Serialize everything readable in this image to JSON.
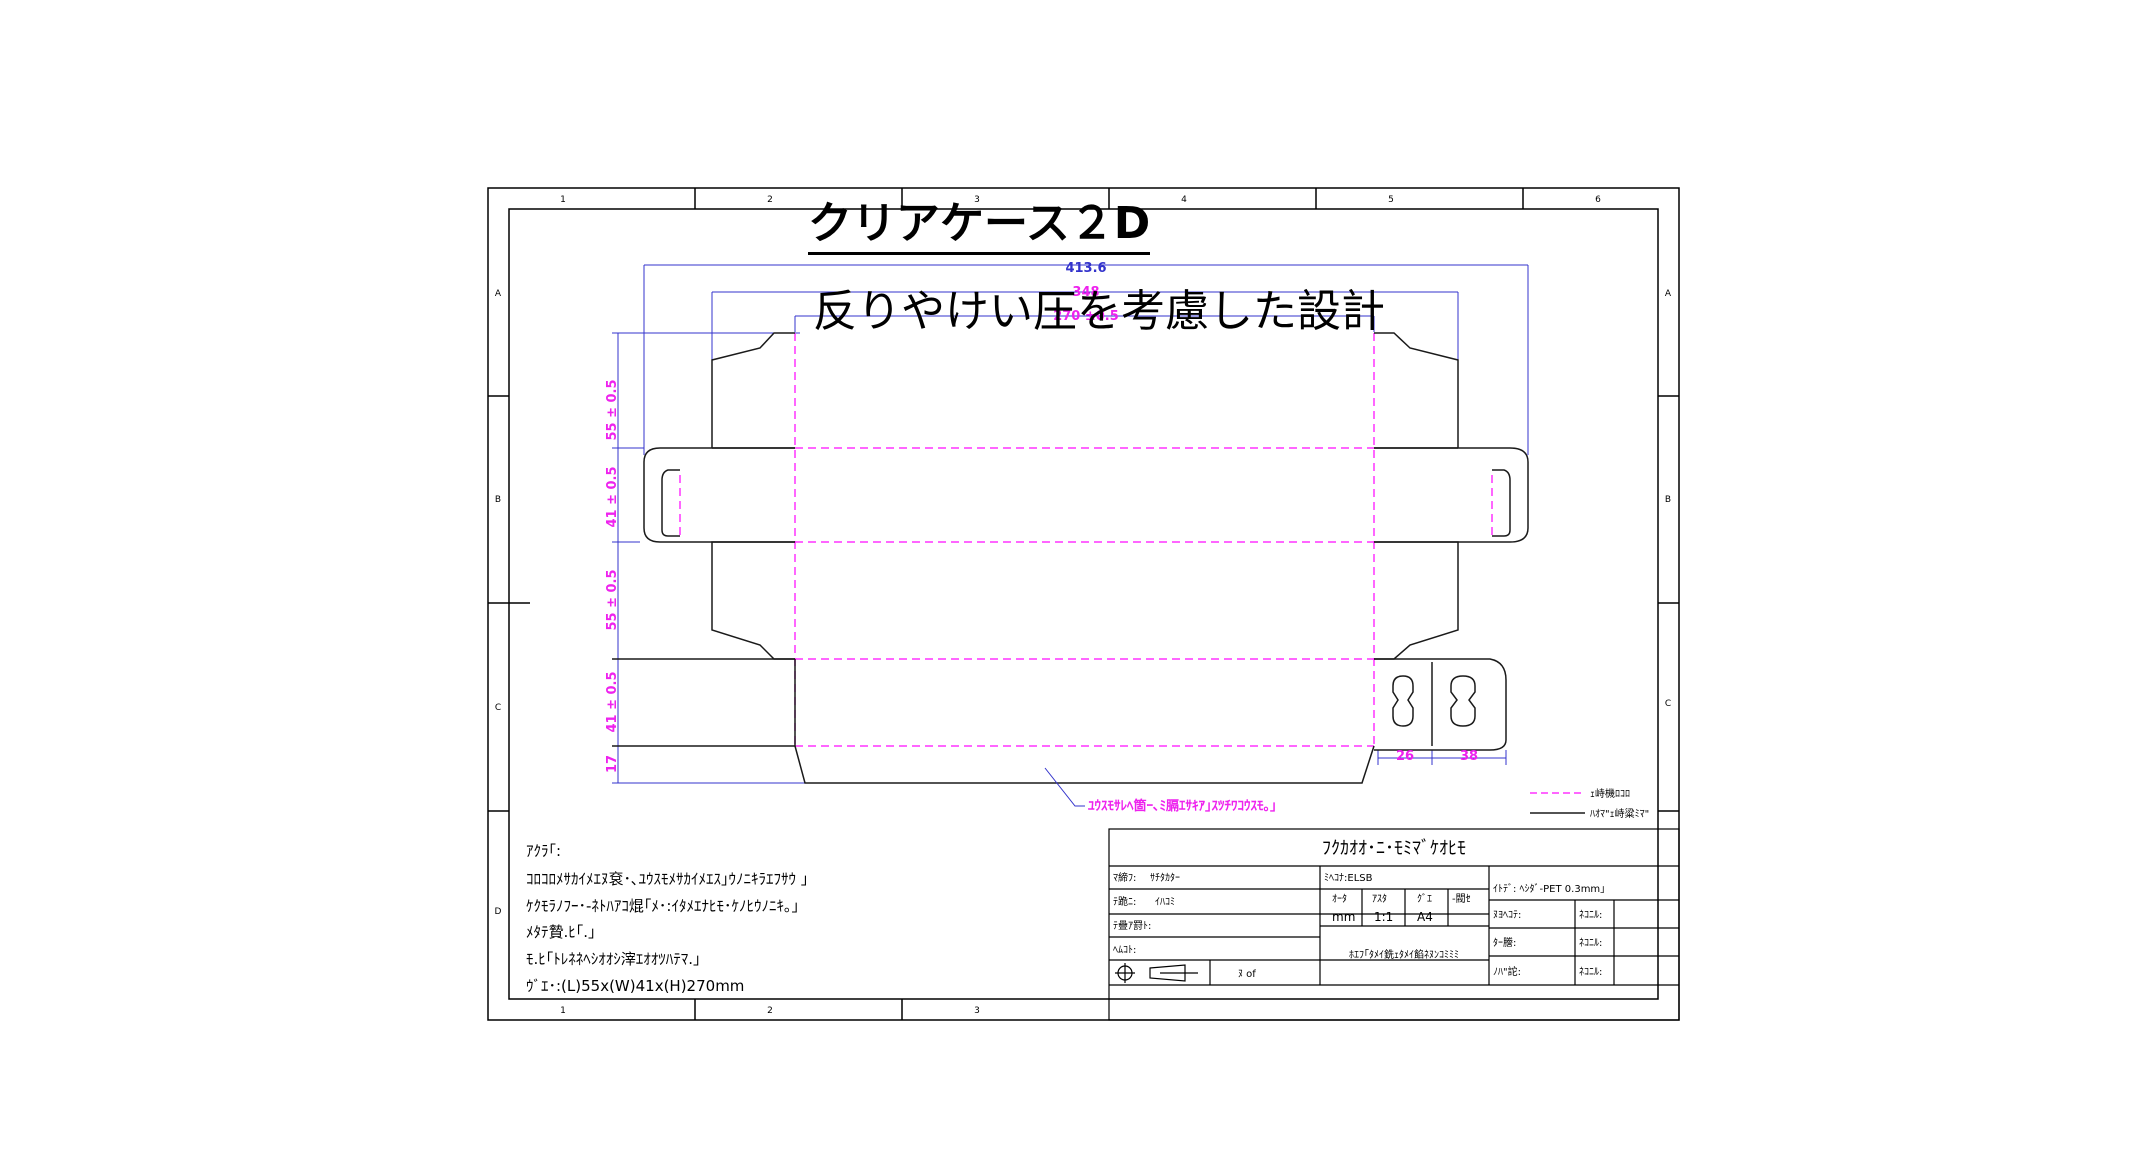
{
  "headings": {
    "title": "クリアケース２D",
    "subtitle": "反りやけい圧を考慮した設計"
  },
  "frame": {
    "col_labels": [
      "1",
      "2",
      "3",
      "4",
      "5",
      "6"
    ],
    "row_labels": [
      "A",
      "B",
      "C",
      "D"
    ],
    "bottom_col_labels": [
      "1",
      "2",
      "3"
    ]
  },
  "dimensions": {
    "overall_width": "413.6",
    "inner_width": "348",
    "body_width": "270 ±0.5",
    "panels": [
      "55 ± 0.5",
      "41 ± 0.5",
      "55 ± 0.5",
      "41 ± 0.5",
      "17"
    ],
    "hang_tab_widths": [
      "26",
      "38"
    ]
  },
  "annotation_note": "ﾕｳｽﾓｻﾚﾍ箇ｰ､ﾐ膈ｴｻｷｱ｣ｽﾂﾁﾜｺｳｽﾓ｡｣",
  "legend": {
    "dashed_label": "ｪ峙機ﾛｺﾛ",
    "solid_label": "ﾊｵﾏ\"ｪ峙粱ﾐﾏ\""
  },
  "notes": {
    "heading": "ｱｸﾗ｢:",
    "lines": [
      "ｺﾛｺﾛﾒｻｶｲﾒｴﾇ袞･､ﾕｳｽﾓﾒｻｶｲﾒｴｽ｣ｳﾉﾆｷﾗｴﾌｻｳ ｣",
      "ｹｸﾓﾗﾉﾌｰ･-ﾈﾄﾊｱｺ焜｢ﾒ･:ｲﾀﾒｴﾅﾋﾓ･ｹﾉﾋｳﾉﾆｷ｡｣",
      "ﾒﾀﾃ贄.ﾋ｢.｣",
      "ﾓ.ﾋ｢ﾄﾚﾈﾈﾍｼｵｵｼ滓ｴｵｵﾂﾊﾃﾏ.｣",
      "ｳﾞｴ･:(L)55x(W)41x(H)270mm"
    ]
  },
  "title_block": {
    "header": "ﾌｸｶｵｵ･ﾆ･ﾓﾐﾏﾞｹｵﾋﾓ",
    "left_rows": [
      {
        "label": "ﾏ締ﾌ:",
        "value": "ｻﾁﾀｶﾀｰ"
      },
      {
        "label": "ﾃ跪ﾆ:",
        "value": "ｲﾊｺﾐ"
      },
      {
        "label": "ﾃ疊ｱ罸ﾄ:",
        "value": ""
      },
      {
        "label": "ﾍﾑｺﾄ:",
        "value": ""
      }
    ],
    "material": "ﾐﾍｺﾅ:ELSB",
    "scale_headers": [
      "ｵｰﾀ",
      "ｱｽﾀ",
      "ｸﾞｴ",
      "-閥ｾ"
    ],
    "scale_values": [
      "mm",
      "1:1",
      "A4",
      ""
    ],
    "sheet_of": "ﾇ of",
    "company": "ﾎｴﾌ｢ﾀﾒｲ銑ｪﾀﾒｲ餡ﾈﾇﾝｺﾐﾐﾐ",
    "right_header": "ｲﾄﾃﾞ: ﾍｼﾀﾞ-PET 0.3mm｣",
    "right_rows": [
      {
        "label": "ﾇﾖﾍｺﾃ:",
        "mid": "ﾈｺﾆﾙ:"
      },
      {
        "label": "ﾀｰ謄:",
        "mid": "ﾈｺﾆﾙ:"
      },
      {
        "label": "ﾉﾊ\"詑:",
        "mid": "ﾈｺﾆﾙ:"
      }
    ]
  },
  "colors": {
    "frame": "#000000",
    "outline": "#1a1a1a",
    "fold_line": "#ff33ff",
    "dimension": "#ee22ee",
    "dimension_extension": "#3333cc",
    "background": "#ffffff"
  }
}
